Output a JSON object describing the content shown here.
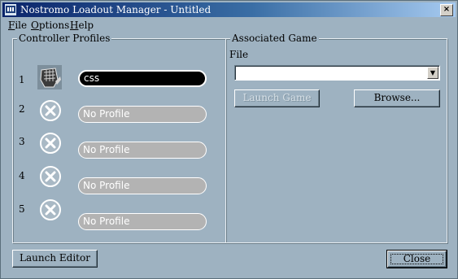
{
  "window": {
    "title": "Nostromo Loadout Manager - Untitled",
    "close_glyph": "×"
  },
  "menu": [
    {
      "accel": "F",
      "rest": "ile"
    },
    {
      "accel": "O",
      "rest": "ptions"
    },
    {
      "accel": "H",
      "rest": "elp"
    }
  ],
  "profiles": {
    "legend": "Controller Profiles",
    "slots": [
      {
        "num": "1",
        "icon": "gamepad-device-icon",
        "name": "css",
        "active": true
      },
      {
        "num": "2",
        "icon": "empty-slot-icon",
        "name": "No Profile",
        "active": false
      },
      {
        "num": "3",
        "icon": "empty-slot-icon",
        "name": "No Profile",
        "active": false
      },
      {
        "num": "4",
        "icon": "empty-slot-icon",
        "name": "No Profile",
        "active": false
      },
      {
        "num": "5",
        "icon": "empty-slot-icon",
        "name": "No Profile",
        "active": false
      }
    ]
  },
  "game": {
    "legend": "Associated Game",
    "file_label": "File",
    "file_value": "",
    "launch_game_label": "Launch Game",
    "browse_label": "Browse..."
  },
  "footer": {
    "launch_editor_label": "Launch Editor",
    "close_label": "Close"
  },
  "colors": {
    "background": "#9eb2c1",
    "title_blue": "#0a246a",
    "profile_empty": "#b3b3b3"
  }
}
